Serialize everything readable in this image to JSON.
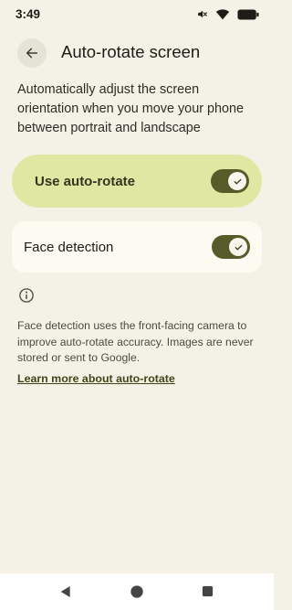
{
  "status_bar": {
    "time": "3:49",
    "icons": [
      "mute-icon",
      "wifi-icon",
      "battery-icon"
    ]
  },
  "header": {
    "back_icon": "arrow-left-icon",
    "title": "Auto-rotate screen"
  },
  "description": "Automatically adjust the screen orientation when you move your phone between portrait and landscape",
  "settings": {
    "auto_rotate": {
      "label": "Use auto-rotate",
      "enabled": true
    },
    "face_detection": {
      "label": "Face detection",
      "enabled": true
    }
  },
  "info": {
    "icon": "info-icon",
    "text": "Face detection uses the front-facing camera to improve auto-rotate accuracy. Images are never stored or sent to Google.",
    "link": "Learn more about auto-rotate"
  },
  "nav_bar": {
    "buttons": [
      "back-triangle-icon",
      "home-circle-icon",
      "recents-square-icon"
    ]
  },
  "colors": {
    "background": "#f4f2e6",
    "accent_card": "#dfe7a2",
    "toggle_on": "#555c2a"
  }
}
